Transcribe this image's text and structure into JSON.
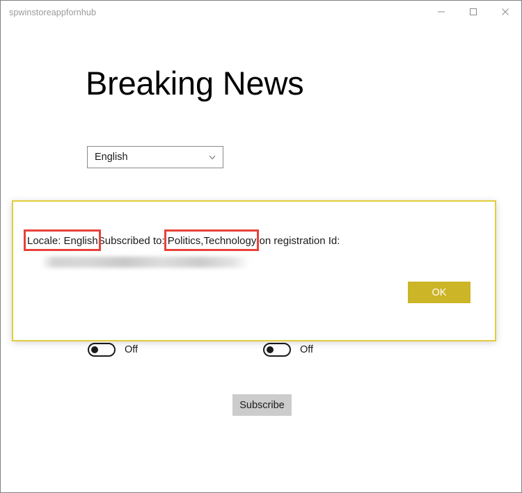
{
  "window": {
    "title": "spwinstoreappfornhub",
    "controls": [
      {
        "name": "minimize",
        "glyph": "minimize-icon"
      },
      {
        "name": "maximize",
        "glyph": "maximize-icon"
      },
      {
        "name": "close",
        "glyph": "close-icon"
      }
    ]
  },
  "main": {
    "heading": "Breaking News",
    "locale_select": {
      "value": "English",
      "icon": "chevron-down-icon"
    },
    "toggles": [
      {
        "label": "Off",
        "state": "off"
      },
      {
        "label": "Off",
        "state": "off"
      }
    ],
    "subscribe_button": "Subscribe"
  },
  "dialog": {
    "message_parts": {
      "locale": "Locale: English",
      "middle": "Subscribed to: ",
      "topics": "Politics,Technology",
      "tail": " on registration Id:"
    },
    "registration_id": "",
    "ok_button": "OK"
  },
  "colors": {
    "dialog_border": "#e2cb3d",
    "ok_button": "#ccb527",
    "subscribe_button": "#cccccc",
    "annotation_box": "#e8413a",
    "window_border": "#808080",
    "title_text": "#9a9a9a"
  }
}
